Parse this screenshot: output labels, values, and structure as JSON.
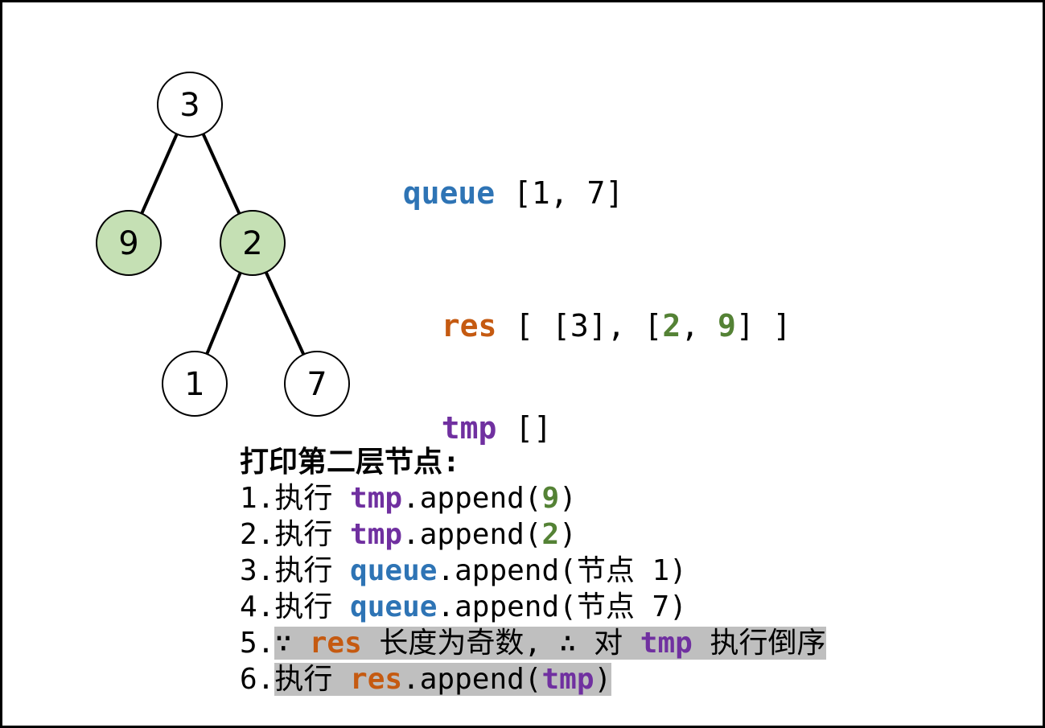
{
  "tree": {
    "nodes": [
      {
        "id": "n3",
        "label": "3",
        "highlighted": false
      },
      {
        "id": "n9",
        "label": "9",
        "highlighted": true
      },
      {
        "id": "n2",
        "label": "2",
        "highlighted": true
      },
      {
        "id": "n1",
        "label": "1",
        "highlighted": false
      },
      {
        "id": "n7",
        "label": "7",
        "highlighted": false
      }
    ],
    "edges": [
      [
        "n3",
        "n9"
      ],
      [
        "n3",
        "n2"
      ],
      [
        "n2",
        "n1"
      ],
      [
        "n2",
        "n7"
      ]
    ],
    "colors": {
      "highlight_fill": "#c5e0b4",
      "normal_fill": "#ffffff",
      "stroke": "#000000"
    }
  },
  "queue": {
    "name": "queue",
    "value": "[1, 7]"
  },
  "res": {
    "name": "res",
    "open": "[ [3], [",
    "a": "2",
    "sep": ", ",
    "b": "9",
    "close": "] ]"
  },
  "tmp": {
    "name": "tmp",
    "value": "[]"
  },
  "steps": {
    "title": "打印第二层节点:",
    "s1": {
      "num": "1.",
      "verb": "执行 ",
      "obj": "tmp",
      "call": ".append(",
      "arg": "9",
      "end": ")"
    },
    "s2": {
      "num": "2.",
      "verb": "执行 ",
      "obj": "tmp",
      "call": ".append(",
      "arg": "2",
      "end": ")"
    },
    "s3": {
      "num": "3.",
      "verb": "执行 ",
      "obj": "queue",
      "call": ".append(节点 1)"
    },
    "s4": {
      "num": "4.",
      "verb": "执行 ",
      "obj": "queue",
      "call": ".append(节点 7)"
    },
    "s5": {
      "num": "5.",
      "pre": "∵ ",
      "obj": "res",
      "mid": " 长度为奇数, ∴ 对 ",
      "obj2": "tmp",
      "end": " 执行倒序"
    },
    "s6": {
      "num": "6.",
      "verb": "执行 ",
      "obj": "res",
      "call": ".append(",
      "arg": "tmp",
      "end": ")"
    }
  },
  "colors": {
    "queue": "#2e74b5",
    "res": "#c55a11",
    "tmp": "#7030a0",
    "green_num": "#548235",
    "highlight_bg": "#bfbfbf"
  }
}
